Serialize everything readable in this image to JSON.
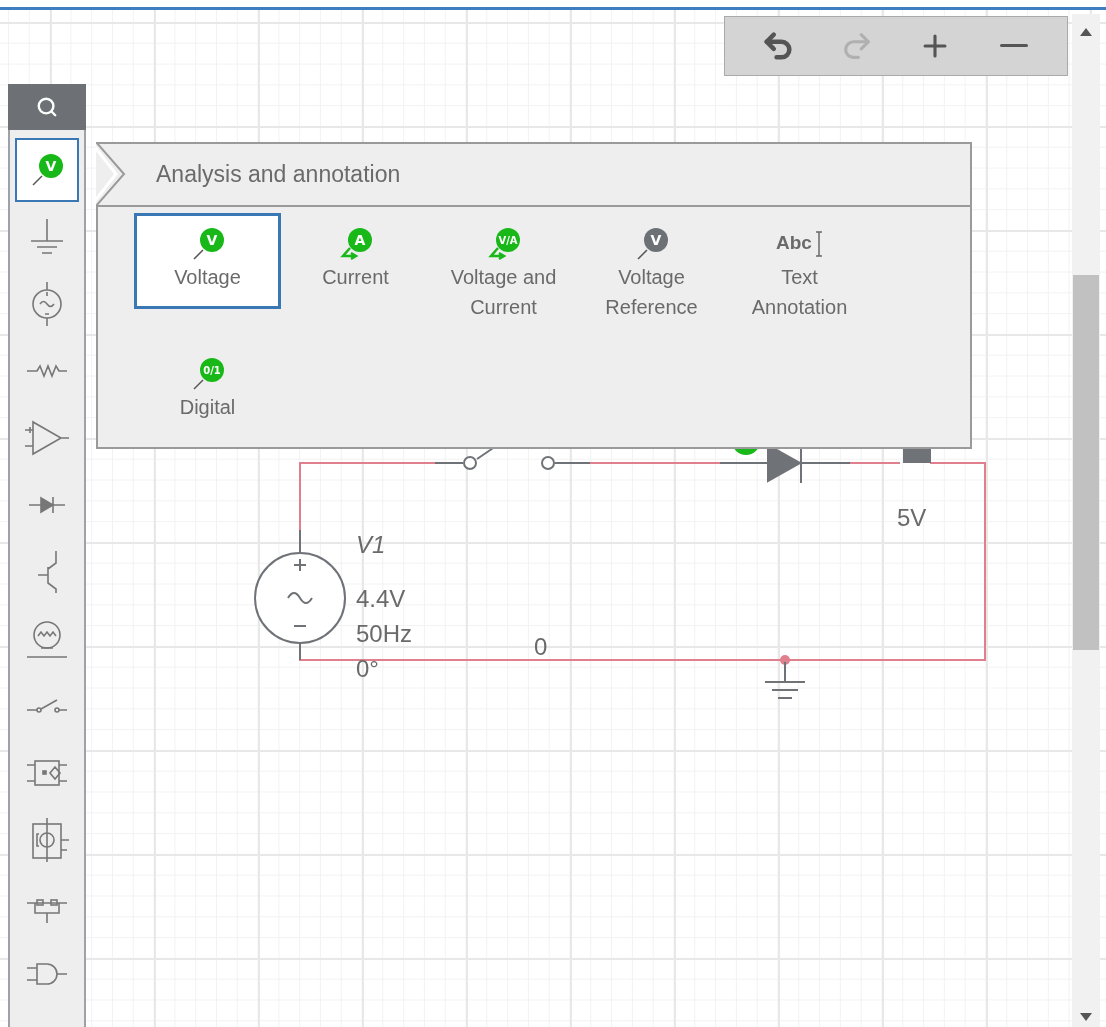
{
  "toolbar": [
    {
      "kind": "undo",
      "disabled": false
    },
    {
      "kind": "redo",
      "disabled": true
    },
    {
      "kind": "zoom_in",
      "disabled": false
    },
    {
      "kind": "zoom_out",
      "disabled": false
    }
  ],
  "sidebar": {
    "items": [
      {
        "kind": "probe",
        "badge": "V",
        "selected": true
      },
      {
        "kind": "ground",
        "selected": false
      },
      {
        "kind": "ac_source",
        "selected": false
      },
      {
        "kind": "resistor",
        "selected": false
      },
      {
        "kind": "opamp",
        "selected": false
      },
      {
        "kind": "diode",
        "selected": false
      },
      {
        "kind": "transistor",
        "selected": false
      },
      {
        "kind": "lamp",
        "selected": false
      },
      {
        "kind": "switch",
        "selected": false
      },
      {
        "kind": "optocoupler",
        "selected": false
      },
      {
        "kind": "relay",
        "selected": false
      },
      {
        "kind": "bridge",
        "selected": false
      },
      {
        "kind": "and_gate",
        "selected": false
      }
    ]
  },
  "popup": {
    "title": "Analysis and annotation",
    "items": [
      {
        "label": "Voltage",
        "kind": "voltage_probe",
        "badge": "V",
        "selected": true
      },
      {
        "label": "Current",
        "kind": "current_probe",
        "badge": "A",
        "selected": false
      },
      {
        "label": "Voltage and Current",
        "kind": "current_probe",
        "badge": "V/A",
        "selected": false
      },
      {
        "label": "Voltage Reference",
        "kind": "reference_probe",
        "badge": "V",
        "selected": false
      },
      {
        "label": "Text Annotation",
        "kind": "text",
        "badge": "Abc",
        "selected": false
      },
      {
        "label": "Digital",
        "kind": "voltage_probe",
        "badge": "0/1",
        "selected": false
      }
    ]
  },
  "schematic": {
    "node_labels": [
      "0"
    ],
    "source": {
      "name": "V1",
      "amplitude": "4.4V",
      "frequency": "50Hz",
      "phase": "0°"
    },
    "battery_voltage": "5V"
  }
}
